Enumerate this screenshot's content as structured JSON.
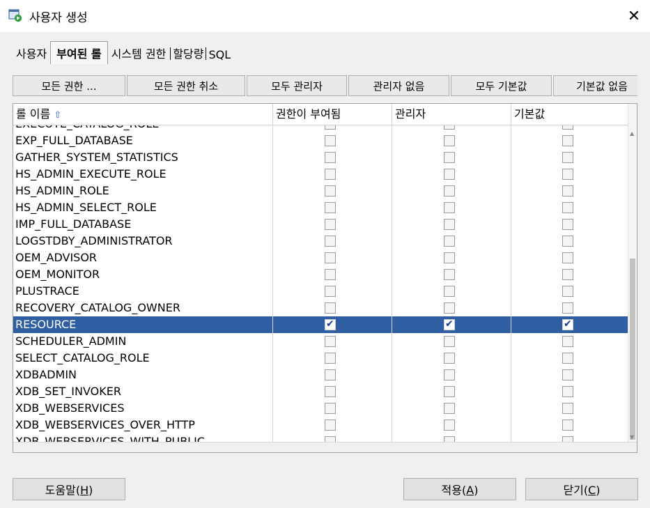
{
  "window": {
    "title": "사용자 생성"
  },
  "tabs": [
    {
      "label": "사용자",
      "active": false
    },
    {
      "label": "부여된 롤",
      "active": true
    },
    {
      "label": "시스템 권한",
      "active": false
    },
    {
      "label": "할당량",
      "active": false
    },
    {
      "label": "SQL",
      "active": false
    }
  ],
  "toolbar": {
    "grant_all": "모든 권한 ...",
    "revoke_all": "모든 권한 취소",
    "all_admin": "모두 관리자",
    "no_admin": "관리자 없음",
    "all_default": "모두 기본값",
    "no_default": "기본값 없음"
  },
  "table": {
    "columns": [
      "롤 이름",
      "권한이 부여됨",
      "관리자",
      "기본값"
    ],
    "rows": [
      {
        "name": "EXECUTE_CATALOG_ROLE",
        "granted": false,
        "admin": false,
        "default": false
      },
      {
        "name": "EXP_FULL_DATABASE",
        "granted": false,
        "admin": false,
        "default": false
      },
      {
        "name": "GATHER_SYSTEM_STATISTICS",
        "granted": false,
        "admin": false,
        "default": false
      },
      {
        "name": "HS_ADMIN_EXECUTE_ROLE",
        "granted": false,
        "admin": false,
        "default": false
      },
      {
        "name": "HS_ADMIN_ROLE",
        "granted": false,
        "admin": false,
        "default": false
      },
      {
        "name": "HS_ADMIN_SELECT_ROLE",
        "granted": false,
        "admin": false,
        "default": false
      },
      {
        "name": "IMP_FULL_DATABASE",
        "granted": false,
        "admin": false,
        "default": false
      },
      {
        "name": "LOGSTDBY_ADMINISTRATOR",
        "granted": false,
        "admin": false,
        "default": false
      },
      {
        "name": "OEM_ADVISOR",
        "granted": false,
        "admin": false,
        "default": false
      },
      {
        "name": "OEM_MONITOR",
        "granted": false,
        "admin": false,
        "default": false
      },
      {
        "name": "PLUSTRACE",
        "granted": false,
        "admin": false,
        "default": false
      },
      {
        "name": "RECOVERY_CATALOG_OWNER",
        "granted": false,
        "admin": false,
        "default": false
      },
      {
        "name": "RESOURCE",
        "granted": true,
        "admin": true,
        "default": true,
        "selected": true
      },
      {
        "name": "SCHEDULER_ADMIN",
        "granted": false,
        "admin": false,
        "default": false
      },
      {
        "name": "SELECT_CATALOG_ROLE",
        "granted": false,
        "admin": false,
        "default": false
      },
      {
        "name": "XDBADMIN",
        "granted": false,
        "admin": false,
        "default": false
      },
      {
        "name": "XDB_SET_INVOKER",
        "granted": false,
        "admin": false,
        "default": false
      },
      {
        "name": "XDB_WEBSERVICES",
        "granted": false,
        "admin": false,
        "default": false
      },
      {
        "name": "XDB_WEBSERVICES_OVER_HTTP",
        "granted": false,
        "admin": false,
        "default": false
      },
      {
        "name": "XDB_WEBSERVICES_WITH_PUBLIC",
        "granted": false,
        "admin": false,
        "default": false
      }
    ]
  },
  "footer": {
    "help": {
      "text": "도움말(",
      "key": "H",
      "end": ")"
    },
    "apply": {
      "text": "적용(",
      "key": "A",
      "end": ")"
    },
    "close": {
      "text": "닫기(",
      "key": "C",
      "end": ")"
    }
  },
  "icons": {
    "app": "user-create-icon",
    "close": "close-icon",
    "sort": "sort-ascending-icon",
    "check": "check-icon"
  },
  "colors": {
    "selection": "#2f5ea3",
    "check": "#1a3a8a",
    "default_check_fill": "#fff7b0"
  }
}
